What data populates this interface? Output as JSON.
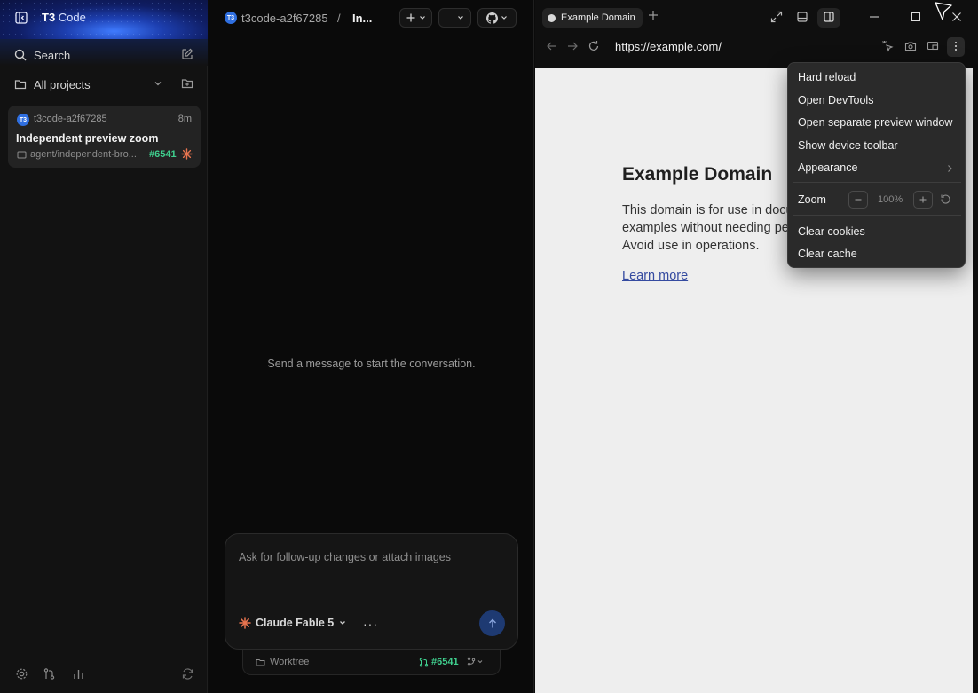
{
  "sidebar": {
    "brand_bold": "T3",
    "brand_light": "Code",
    "search_label": "Search",
    "projects_label": "All projects",
    "thread": {
      "logo": "T3",
      "project": "t3code-a2f67285",
      "age": "8m",
      "title": "Independent preview zoom",
      "branch": "agent/independent-bro...",
      "pr": "#6541"
    }
  },
  "chat": {
    "project": "t3code-a2f67285",
    "separator": "/",
    "thread_title": "In...",
    "empty_message": "Send a message to start the conversation.",
    "composer": {
      "placeholder": "Ask for follow-up changes or attach images",
      "model": "Claude Fable 5",
      "more": "···"
    },
    "worktree": {
      "label": "Worktree",
      "pr": "#6541"
    }
  },
  "preview": {
    "tab_title": "Example Domain",
    "url": "https://example.com/",
    "page": {
      "heading": "Example Domain",
      "paragraph": "This domain is for use in documentation examples without needing permission. Avoid use in operations.",
      "link": "Learn more"
    }
  },
  "menu": {
    "items": [
      "Hard reload",
      "Open DevTools",
      "Open separate preview window",
      "Show device toolbar",
      "Appearance"
    ],
    "zoom_label": "Zoom",
    "zoom_value": "100%",
    "clear_cookies": "Clear cookies",
    "clear_cache": "Clear cache"
  },
  "colors": {
    "accent_blue": "#2f6fe0",
    "pr_green": "#3fcf8e",
    "spark_orange": "#e8744f",
    "send_button": "#1e3a72"
  },
  "icons": [
    "sidebar-toggle-icon",
    "search-icon",
    "compose-icon",
    "folder-icon",
    "chevron-down-icon",
    "new-folder-icon",
    "branch-icon",
    "sparkle-icon",
    "settings-icon",
    "git-compare-icon",
    "chart-icon",
    "refresh-icon",
    "plus-icon",
    "github-icon",
    "arrow-up-icon",
    "expand-icon",
    "panel-bottom-icon",
    "panel-right-icon",
    "minimize-icon",
    "maximize-icon",
    "close-icon",
    "back-icon",
    "forward-icon",
    "reload-icon",
    "pick-element-icon",
    "camera-icon",
    "screen-icon",
    "more-vertical-icon",
    "chevron-right-icon",
    "reset-icon"
  ]
}
